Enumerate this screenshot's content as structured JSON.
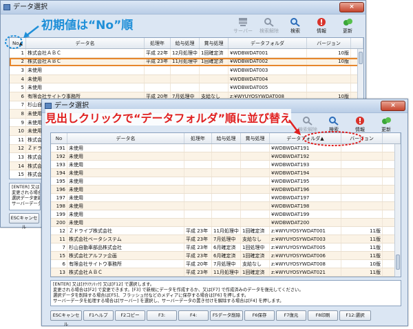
{
  "colors": {
    "accent_blue": "#1f8fd8",
    "accent_red": "#e02020",
    "selection": "#e6862c",
    "row_alt": "#fbf3e6"
  },
  "back_window": {
    "title": "データ選択",
    "close_label": "×",
    "toolbar": [
      {
        "label": "サーバー",
        "icon": "server-icon",
        "enabled": false
      },
      {
        "label": "検索解除",
        "icon": "search-clear-icon",
        "enabled": false
      },
      {
        "label": "検索",
        "icon": "search-icon",
        "enabled": true
      },
      {
        "label": "情報",
        "icon": "info-icon",
        "enabled": true
      },
      {
        "label": "更新",
        "icon": "refresh-icon",
        "enabled": true
      }
    ],
    "columns": [
      "No▲",
      "データ名",
      "処理年",
      "給与処理",
      "賞与処理",
      "データフォルダ",
      "バージョン"
    ],
    "rows": [
      {
        "no": "1",
        "name": "株式会社ＡＢＣ",
        "year": "平成 22年",
        "pay": "12月処理中",
        "bonus": "1回確定済",
        "folder": "¥WDBWDAT001",
        "ver": "10版"
      },
      {
        "no": "2",
        "name": "株式会社ＡＢＣ",
        "year": "平成 23年",
        "pay": "11月処理中",
        "bonus": "1回確定済",
        "folder": "¥WDBWDAT002",
        "ver": "10版"
      },
      {
        "no": "3",
        "name": "未使用",
        "year": "",
        "pay": "",
        "bonus": "",
        "folder": "¥WDBWDAT003",
        "ver": ""
      },
      {
        "no": "4",
        "name": "未使用",
        "year": "",
        "pay": "",
        "bonus": "",
        "folder": "¥WDBWDAT004",
        "ver": ""
      },
      {
        "no": "5",
        "name": "未使用",
        "year": "",
        "pay": "",
        "bonus": "",
        "folder": "¥WDBWDAT005",
        "ver": ""
      },
      {
        "no": "6",
        "name": "有限会社サイトウ事務所",
        "year": "平成 20年",
        "pay": "7月処理中",
        "bonus": "支給なし",
        "folder": "z:¥WYUYOSYWDAT008",
        "ver": "10版"
      },
      {
        "no": "7",
        "name": "杉山自",
        "year": "",
        "pay": "",
        "bonus": "",
        "folder": "",
        "ver": ""
      },
      {
        "no": "8",
        "name": "未使用",
        "year": "",
        "pay": "",
        "bonus": "",
        "folder": "",
        "ver": ""
      },
      {
        "no": "9",
        "name": "未使用",
        "year": "",
        "pay": "",
        "bonus": "",
        "folder": "",
        "ver": ""
      },
      {
        "no": "10",
        "name": "未使用",
        "year": "",
        "pay": "",
        "bonus": "",
        "folder": "",
        "ver": ""
      },
      {
        "no": "11",
        "name": "株式会",
        "year": "",
        "pay": "",
        "bonus": "",
        "folder": "",
        "ver": ""
      },
      {
        "no": "12",
        "name": "Ｚドライ",
        "year": "",
        "pay": "",
        "bonus": "",
        "folder": "",
        "ver": ""
      },
      {
        "no": "13",
        "name": "株式会",
        "year": "",
        "pay": "",
        "bonus": "",
        "folder": "",
        "ver": ""
      },
      {
        "no": "14",
        "name": "株式会",
        "year": "",
        "pay": "",
        "bonus": "",
        "folder": "",
        "ver": ""
      },
      {
        "no": "15",
        "name": "株式会",
        "year": "",
        "pay": "",
        "bonus": "",
        "folder": "",
        "ver": ""
      }
    ],
    "message_lines": [
      "[ENTER] 又は",
      "変更される場合",
      "選択データ更新",
      "サーバーデータを"
    ],
    "esc_label": "ESCキャンセル"
  },
  "annotations": {
    "back": "初期値は“No”順",
    "front": "見出しクリックで“データフォルダ”順に並び替え"
  },
  "front_window": {
    "title": "データ選択",
    "close_label": "×",
    "toolbar": [
      {
        "label": "検索解除",
        "icon": "search-clear-icon",
        "enabled": false
      },
      {
        "label": "検索",
        "icon": "search-icon",
        "enabled": true
      },
      {
        "label": "情報",
        "icon": "info-icon",
        "enabled": true
      },
      {
        "label": "更新",
        "icon": "refresh-icon",
        "enabled": true
      }
    ],
    "columns": [
      "No",
      "データ名",
      "処理年",
      "給与処理",
      "賞与処理",
      "データフォルダ▲",
      "バージョン"
    ],
    "rows": [
      {
        "no": "191",
        "name": "未使用",
        "year": "",
        "pay": "",
        "bonus": "",
        "folder": "¥WDBWDAT191",
        "ver": ""
      },
      {
        "no": "192",
        "name": "未使用",
        "year": "",
        "pay": "",
        "bonus": "",
        "folder": "¥WDBWDAT192",
        "ver": ""
      },
      {
        "no": "193",
        "name": "未使用",
        "year": "",
        "pay": "",
        "bonus": "",
        "folder": "¥WDBWDAT193",
        "ver": ""
      },
      {
        "no": "194",
        "name": "未使用",
        "year": "",
        "pay": "",
        "bonus": "",
        "folder": "¥WDBWDAT194",
        "ver": ""
      },
      {
        "no": "195",
        "name": "未使用",
        "year": "",
        "pay": "",
        "bonus": "",
        "folder": "¥WDBWDAT195",
        "ver": ""
      },
      {
        "no": "196",
        "name": "未使用",
        "year": "",
        "pay": "",
        "bonus": "",
        "folder": "¥WDBWDAT196",
        "ver": ""
      },
      {
        "no": "197",
        "name": "未使用",
        "year": "",
        "pay": "",
        "bonus": "",
        "folder": "¥WDBWDAT197",
        "ver": ""
      },
      {
        "no": "198",
        "name": "未使用",
        "year": "",
        "pay": "",
        "bonus": "",
        "folder": "¥WDBWDAT198",
        "ver": ""
      },
      {
        "no": "199",
        "name": "未使用",
        "year": "",
        "pay": "",
        "bonus": "",
        "folder": "¥WDBWDAT199",
        "ver": ""
      },
      {
        "no": "200",
        "name": "未使用",
        "year": "",
        "pay": "",
        "bonus": "",
        "folder": "¥WDBWDAT200",
        "ver": ""
      },
      {
        "no": "12",
        "name": "Ｚドライブ株式会社",
        "year": "平成 23年",
        "pay": "11月処理中",
        "bonus": "1回確定済",
        "folder": "z:¥WYUYOSYWDAT001",
        "ver": "11版"
      },
      {
        "no": "11",
        "name": "株式会社ベータシステム",
        "year": "平成 23年",
        "pay": "7月処理中",
        "bonus": "支給なし",
        "folder": "z:¥WYUYOSYWDAT003",
        "ver": "11版"
      },
      {
        "no": "7",
        "name": "杉山自動車部品株式会社",
        "year": "平成 23年",
        "pay": "6月確定済",
        "bonus": "1回処理中",
        "folder": "z:¥WYUYOSYWDAT005",
        "ver": "11版"
      },
      {
        "no": "15",
        "name": "株式会社アルファ企画",
        "year": "平成 23年",
        "pay": "6月確定済",
        "bonus": "1回確定済",
        "folder": "z:¥WYUYOSYWDAT006",
        "ver": "11版"
      },
      {
        "no": "6",
        "name": "有限会社サイトウ事務所",
        "year": "平成 20年",
        "pay": "7月処理中",
        "bonus": "支給なし",
        "folder": "z:¥WYUYOSYWDAT008",
        "ver": "10版"
      },
      {
        "no": "13",
        "name": "株式会社ＡＢＣ",
        "year": "平成 23年",
        "pay": "11月処理中",
        "bonus": "1回確定済",
        "folder": "z:¥WYUYOSYWDAT021",
        "ver": "11版"
      }
    ],
    "message_lines": [
      "[ENTER] 又は[ｵｸﾘｸｼﾘｯｸ] 又は[F12] で選択します。",
      "変更される場合は[F2] で変更できます。[F3] で新規にデータを作成するか、又は[F7] で作成済みのデータを復元してください。",
      "選択データを削除する場合は[F5]、フラッシュ付などのメディアに保存する場合は[F6] を押します。",
      "サーバーデータを処理する場合は[サーバー] を選択し、サーバーデータの置き付けを解除する場合は[F4] を押します。"
    ],
    "fkeys": [
      "ESCキャンセル",
      "F1ヘルプ",
      "F2コピー",
      "F3:",
      "F4:",
      "F5データ削除",
      "F6保存",
      "F7復元",
      "F8印刷",
      "F12:選択"
    ]
  }
}
